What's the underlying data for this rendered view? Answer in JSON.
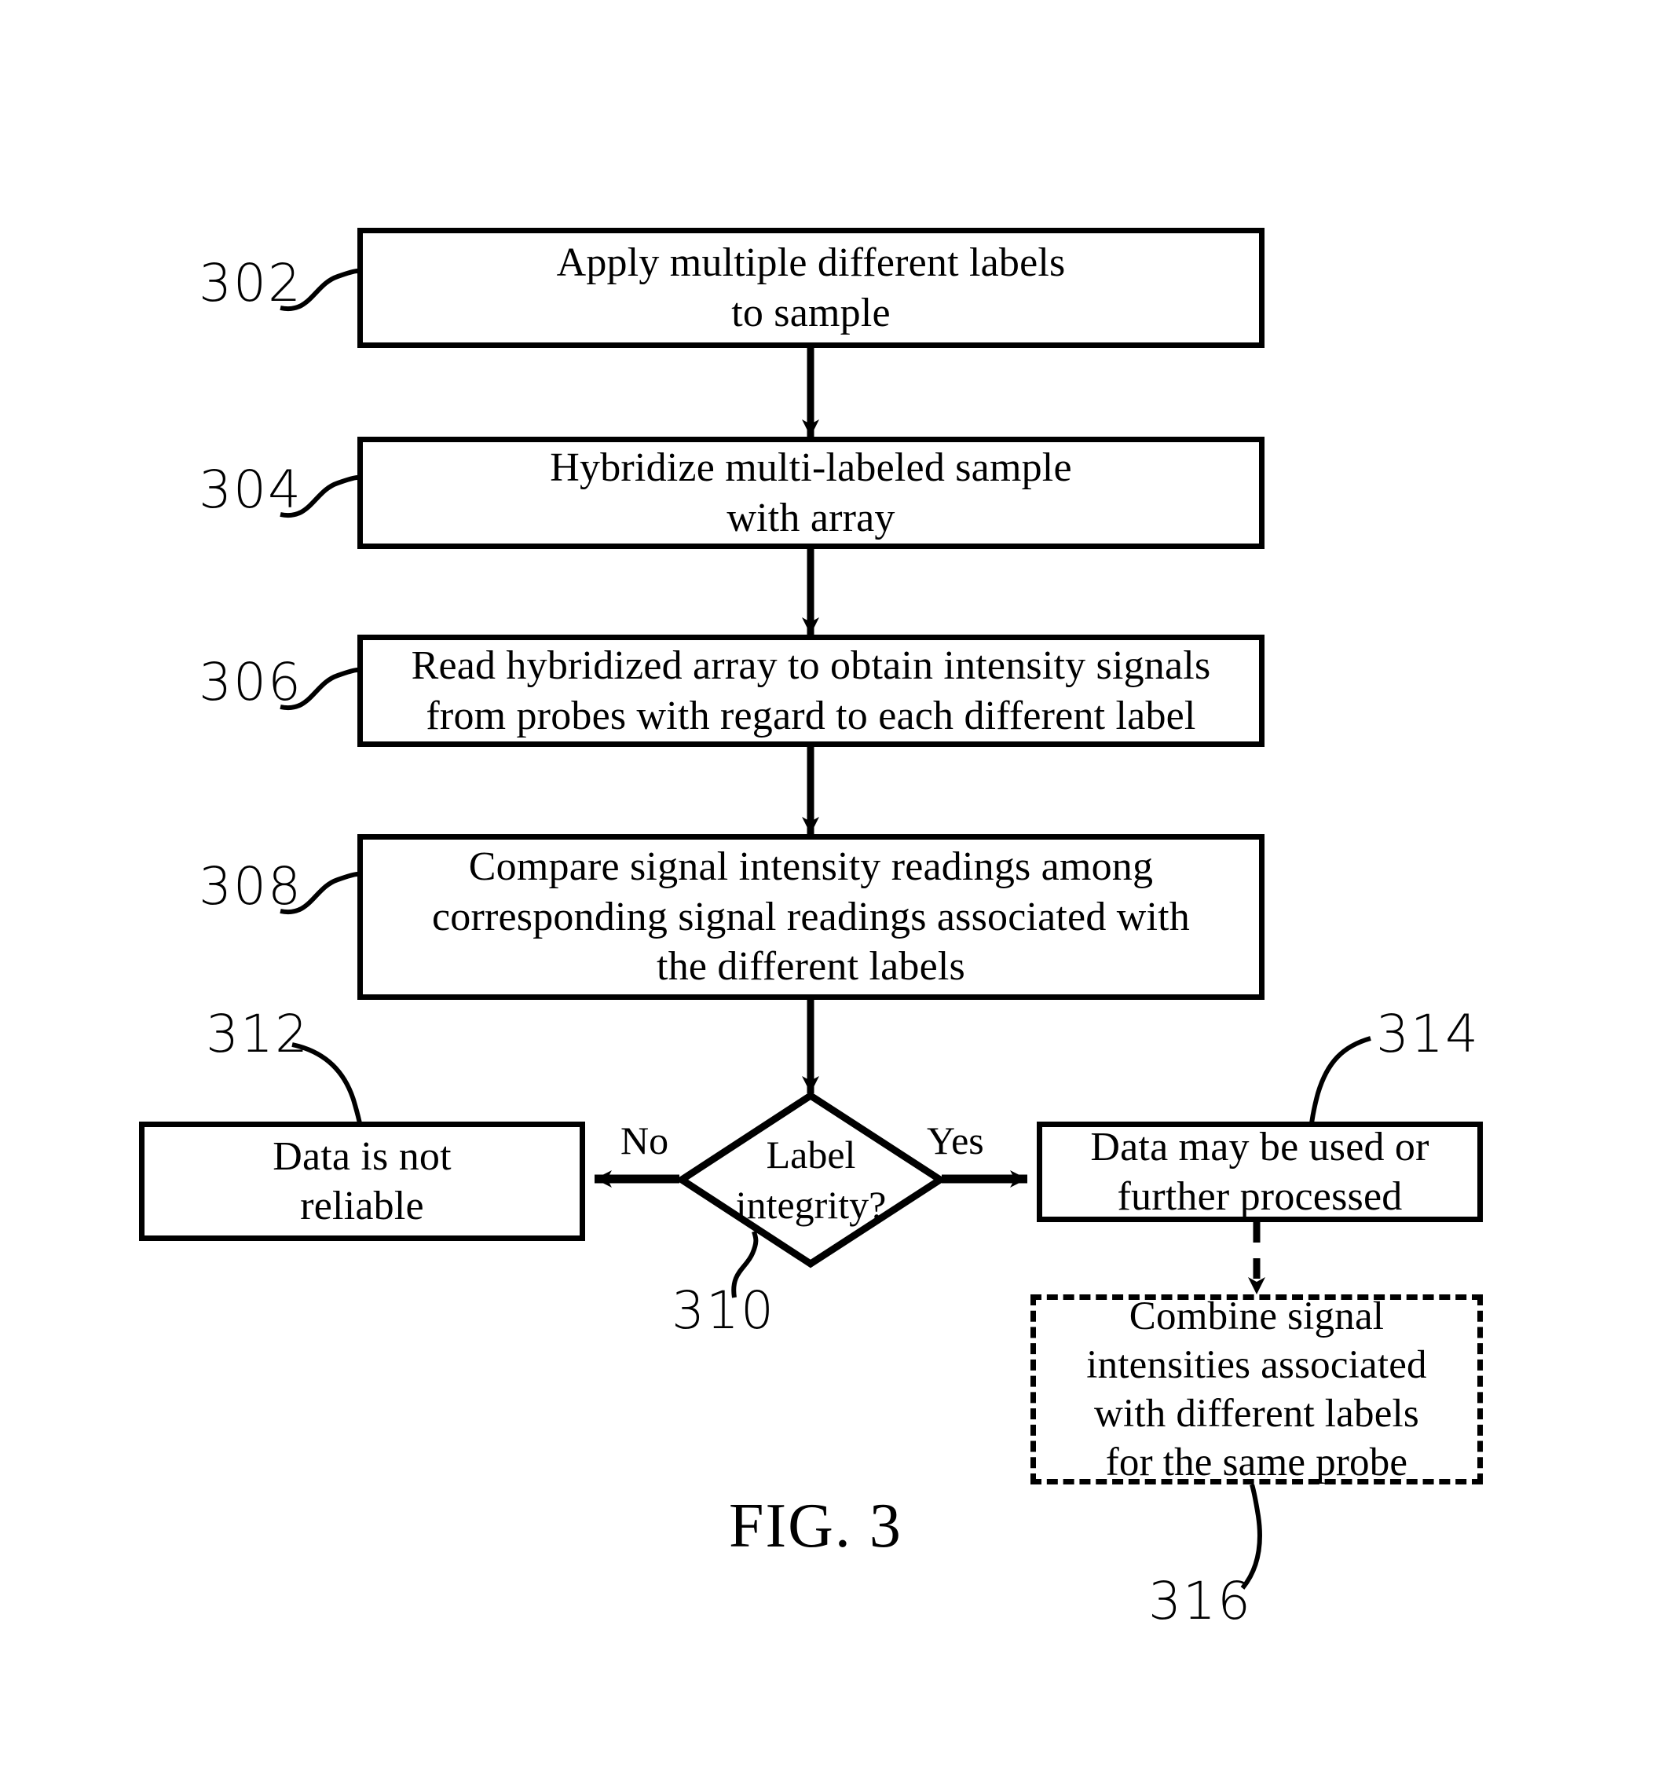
{
  "figure": {
    "caption": "FIG. 3",
    "title": "Flowchart for multi-label array hybridization and label integrity check"
  },
  "nodes": [
    {
      "ref": "302",
      "shape": "process",
      "text": "Apply multiple different labels\nto sample"
    },
    {
      "ref": "304",
      "shape": "process",
      "text": "Hybridize multi-labeled sample\nwith array"
    },
    {
      "ref": "306",
      "shape": "process",
      "text": "Read hybridized array to obtain intensity signals\nfrom probes with regard to each different label"
    },
    {
      "ref": "308",
      "shape": "process",
      "text": "Compare signal intensity readings among\ncorresponding signal readings associated with\nthe different labels"
    },
    {
      "ref": "310",
      "shape": "decision",
      "text": "Label\nintegrity?"
    },
    {
      "ref": "312",
      "shape": "process",
      "text": "Data is not\nreliable"
    },
    {
      "ref": "314",
      "shape": "process",
      "text": "Data may be used or\nfurther processed"
    },
    {
      "ref": "316",
      "shape": "process-optional",
      "text": "Combine signal\nintensities associated\nwith different labels\nfor the same probe"
    }
  ],
  "edges": {
    "no_label": "No",
    "yes_label": "Yes"
  },
  "refnums": {
    "n302": "302",
    "n304": "304",
    "n306": "306",
    "n308": "308",
    "n310": "310",
    "n312": "312",
    "n314": "314",
    "n316": "316"
  },
  "colors": {
    "stroke": "#000000",
    "background": "#ffffff"
  }
}
